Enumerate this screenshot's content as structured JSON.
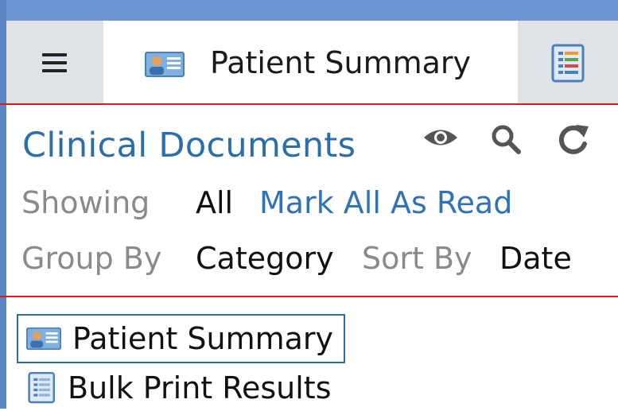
{
  "tabs": {
    "active_label": "Patient Summary"
  },
  "panel": {
    "title": "Clinical Documents",
    "showing_label": "Showing",
    "showing_value": "All",
    "mark_all_label": "Mark All As Read",
    "group_by_label": "Group By",
    "group_by_value": "Category",
    "sort_by_label": "Sort By",
    "sort_by_value": "Date"
  },
  "documents": [
    {
      "label": "Patient Summary",
      "icon": "patient-card-icon",
      "selected": true
    },
    {
      "label": "Bulk Print Results",
      "icon": "document-list-icon",
      "selected": false
    }
  ],
  "colors": {
    "accent": "#2f72b5",
    "divider": "#d41e1e",
    "window_border": "#5b86c8"
  }
}
